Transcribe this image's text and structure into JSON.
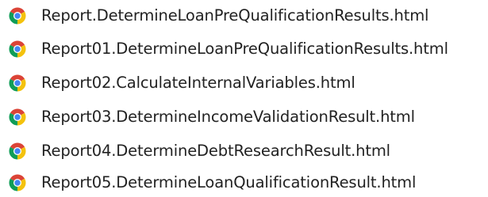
{
  "files": [
    {
      "name": "Report.DetermineLoanPreQualificationResults.html",
      "icon": "chrome-html-file-icon"
    },
    {
      "name": "Report01.DetermineLoanPreQualificationResults.html",
      "icon": "chrome-html-file-icon"
    },
    {
      "name": "Report02.CalculateInternalVariables.html",
      "icon": "chrome-html-file-icon"
    },
    {
      "name": "Report03.DetermineIncomeValidationResult.html",
      "icon": "chrome-html-file-icon"
    },
    {
      "name": "Report04.DetermineDebtResearchResult.html",
      "icon": "chrome-html-file-icon"
    },
    {
      "name": "Report05.DetermineLoanQualificationResult.html",
      "icon": "chrome-html-file-icon"
    }
  ],
  "colors": {
    "chrome_red": "#db4437",
    "chrome_green": "#0f9d58",
    "chrome_yellow": "#f4c20d",
    "chrome_blue": "#4285f4",
    "text": "#222222"
  }
}
